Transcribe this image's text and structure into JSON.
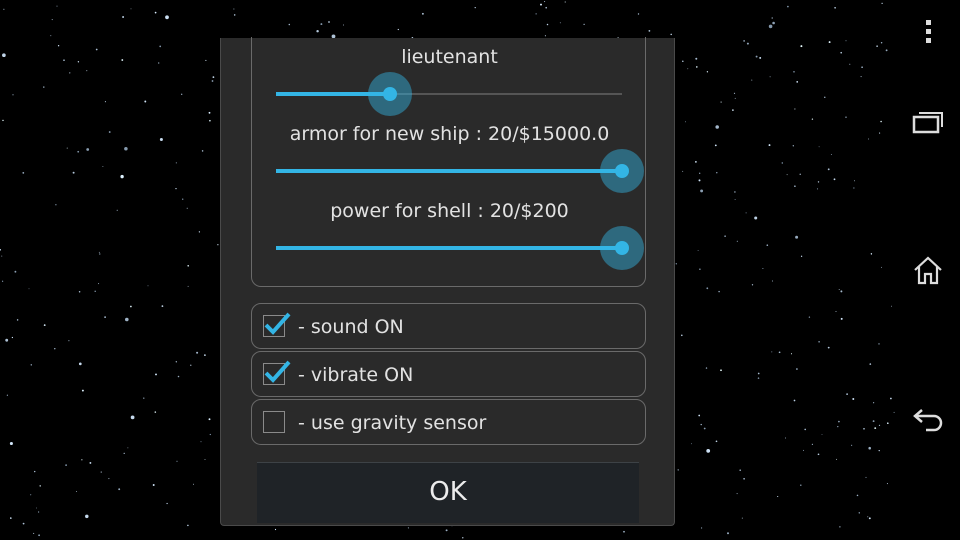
{
  "dialog": {
    "sliders": [
      {
        "label": "lieutenant",
        "value": 0.33
      },
      {
        "label": "armor for new ship : 20/$15000.0",
        "value": 1.0
      },
      {
        "label": "power for shell : 20/$200",
        "value": 1.0
      }
    ],
    "options": [
      {
        "label": "- sound ON",
        "checked": true
      },
      {
        "label": "- vibrate ON",
        "checked": true
      },
      {
        "label": "- use gravity sensor",
        "checked": false
      }
    ],
    "ok_label": "OK"
  },
  "navbar": {
    "icons": [
      "overflow-menu-icon",
      "recent-apps-icon",
      "home-icon",
      "back-icon"
    ]
  },
  "colors": {
    "accent": "#33b5e5",
    "dialog_bg": "#2a2a2a",
    "background": "#000000"
  }
}
